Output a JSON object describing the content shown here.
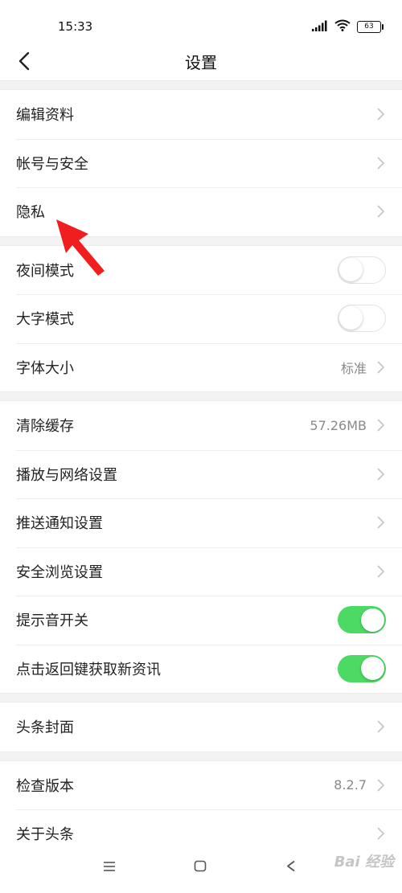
{
  "status_bar": {
    "time": "15:33",
    "battery_level": "63"
  },
  "header": {
    "title": "设置",
    "back_icon": "chevron-left-icon"
  },
  "sections": [
    {
      "rows": [
        {
          "label": "编辑资料",
          "control": "chevron"
        },
        {
          "label": "帐号与安全",
          "control": "chevron"
        },
        {
          "label": "隐私",
          "control": "chevron"
        }
      ]
    },
    {
      "rows": [
        {
          "label": "夜间模式",
          "control": "toggle",
          "on": false
        },
        {
          "label": "大字模式",
          "control": "toggle",
          "on": false
        },
        {
          "label": "字体大小",
          "value": "标准",
          "control": "chevron"
        }
      ]
    },
    {
      "rows": [
        {
          "label": "清除缓存",
          "value": "57.26MB",
          "control": "chevron"
        },
        {
          "label": "播放与网络设置",
          "control": "chevron"
        },
        {
          "label": "推送通知设置",
          "control": "chevron"
        },
        {
          "label": "安全浏览设置",
          "control": "chevron"
        },
        {
          "label": "提示音开关",
          "control": "toggle",
          "on": true
        },
        {
          "label": "点击返回键获取新资讯",
          "control": "toggle",
          "on": true
        }
      ]
    },
    {
      "rows": [
        {
          "label": "头条封面",
          "control": "chevron"
        }
      ]
    },
    {
      "rows": [
        {
          "label": "检查版本",
          "value": "8.2.7",
          "control": "chevron"
        },
        {
          "label": "关于头条",
          "control": "chevron"
        }
      ]
    }
  ],
  "colors": {
    "toggle_on": "#4cd964",
    "annotation_arrow": "#f01e1e"
  },
  "system_nav": {
    "icons": [
      "menu-icon",
      "home-square-icon",
      "back-triangle-icon"
    ]
  },
  "watermark": {
    "text": "Bai 经验"
  }
}
